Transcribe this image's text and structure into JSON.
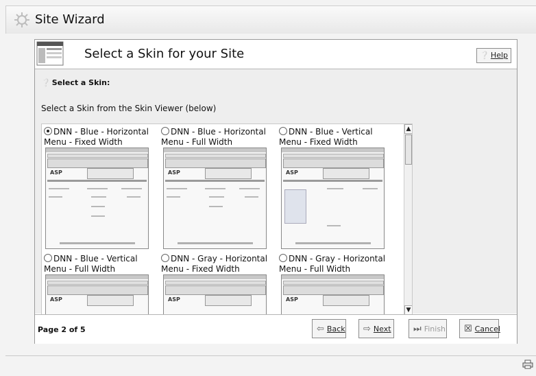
{
  "window": {
    "title": "Site Wizard"
  },
  "header": {
    "title": "Select a Skin for your Site",
    "help_label": "Help"
  },
  "body": {
    "heading": "Select a Skin:",
    "instruction": "Select a Skin from the Skin Viewer (below)"
  },
  "skins": [
    {
      "line1": "DNN - Blue - Horizontal",
      "line2": "Menu - Fixed Width",
      "selected": true
    },
    {
      "line1": "DNN - Blue - Horizontal",
      "line2": "Menu - Full Width",
      "selected": false
    },
    {
      "line1": "DNN - Blue - Vertical",
      "line2": "Menu - Fixed Width",
      "selected": false
    },
    {
      "line1": "DNN - Blue - Vertical",
      "line2": "Menu - Full Width",
      "selected": false
    },
    {
      "line1": "DNN - Gray - Horizontal",
      "line2": "Menu - Fixed Width",
      "selected": false
    },
    {
      "line1": "DNN - Gray - Horizontal",
      "line2": "Menu - Full Width",
      "selected": false
    }
  ],
  "footer": {
    "page_indicator": "Page 2 of 5",
    "back_label": "Back",
    "next_label": "Next",
    "finish_label": "Finish",
    "cancel_label": "Cancel"
  }
}
